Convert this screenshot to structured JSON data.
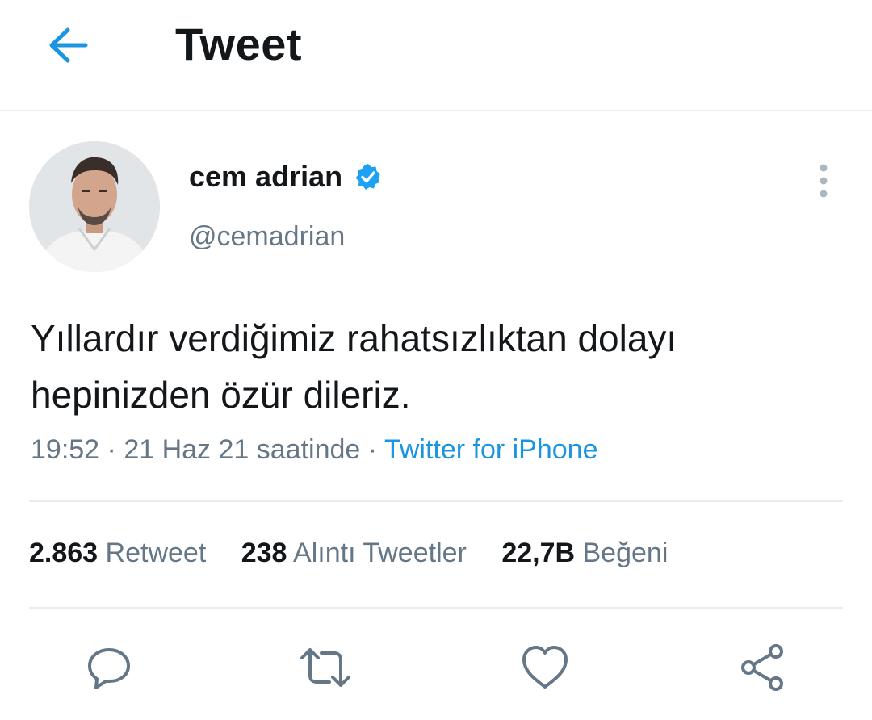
{
  "header": {
    "title": "Tweet"
  },
  "tweet": {
    "display_name": "cem adrian",
    "handle": "@cemadrian",
    "text": "Yıllardır verdiğimiz rahatsızlıktan dolayı hepinizden özür dileriz.",
    "time": "19:52",
    "date": "21 Haz 21 saatinde",
    "separator": "·",
    "source": "Twitter for iPhone"
  },
  "stats": [
    {
      "num": "2.863",
      "label": "Retweet"
    },
    {
      "num": "238",
      "label": "Alıntı Tweetler"
    },
    {
      "num": "22,7B",
      "label": "Beğeni"
    }
  ],
  "icons": {
    "back": "arrow-left-icon",
    "verified": "verified-badge-icon",
    "more": "more-vertical-icon",
    "reply": "reply-icon",
    "retweet": "retweet-icon",
    "like": "heart-icon",
    "share": "share-icon"
  },
  "colors": {
    "accent": "#1b95e0",
    "text_primary": "#14171a",
    "text_secondary": "#657786",
    "divider": "#e6ecf0"
  }
}
